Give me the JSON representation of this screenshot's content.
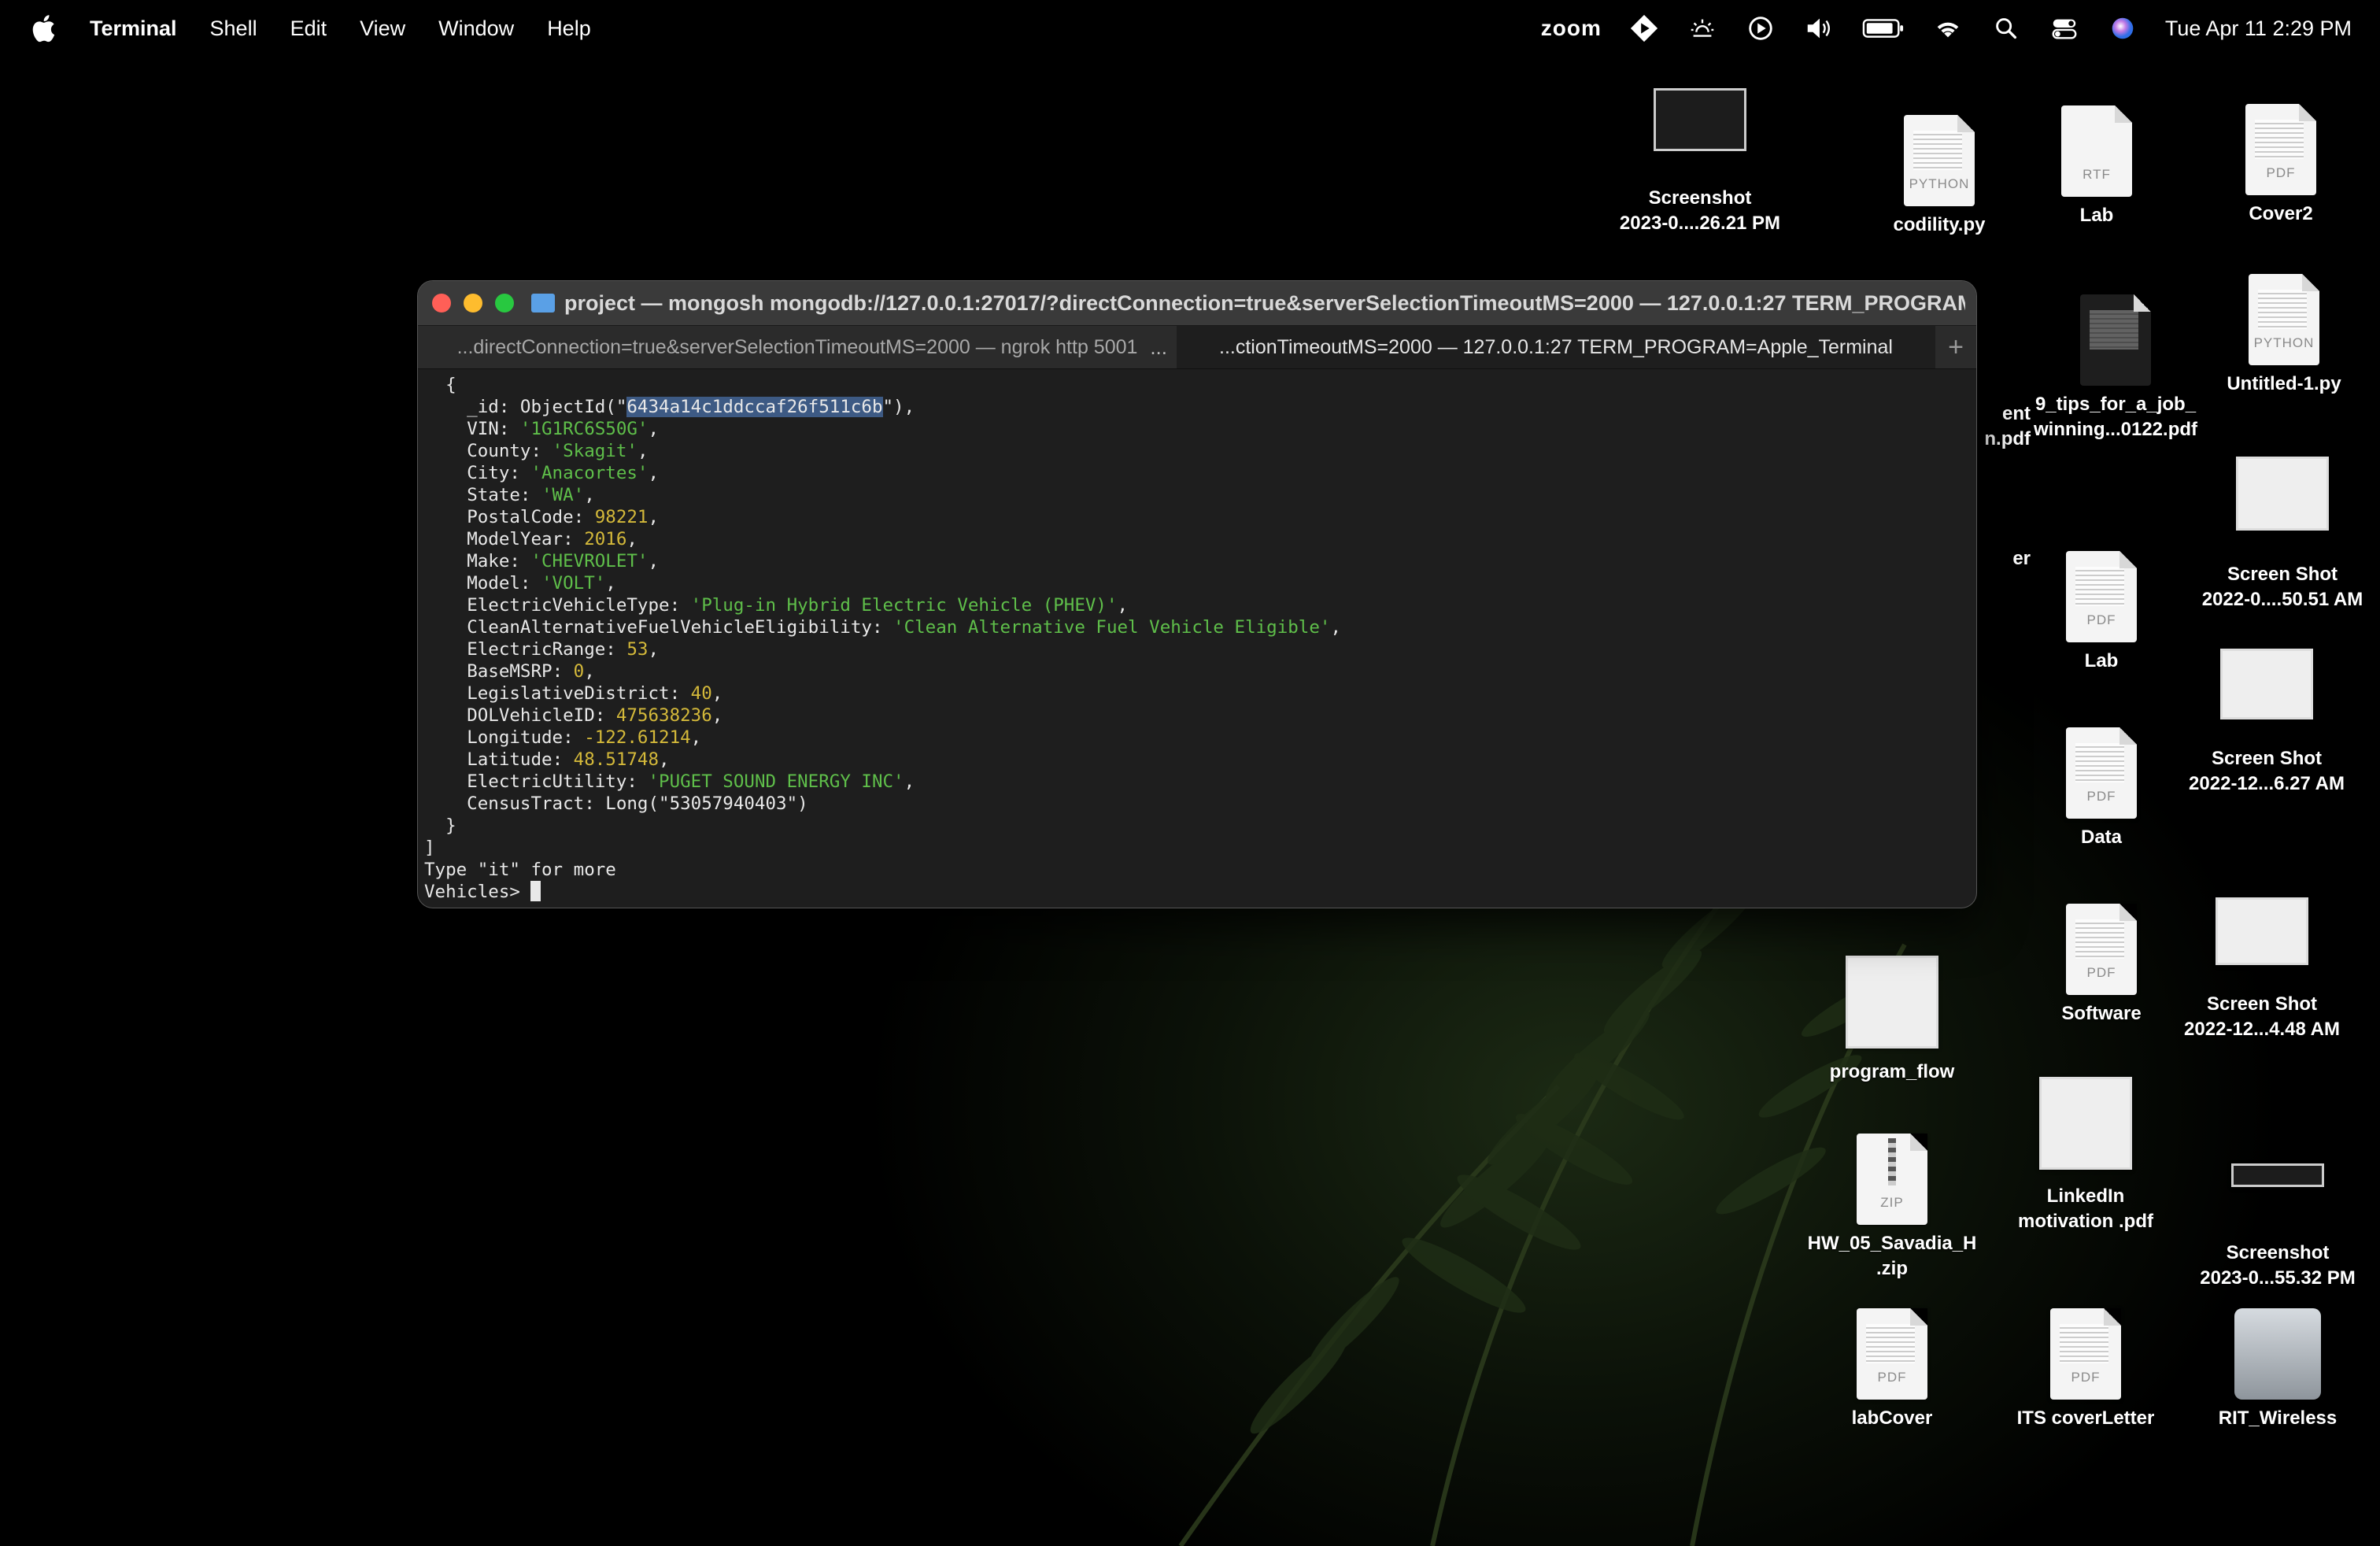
{
  "menubar": {
    "app_name": "Terminal",
    "items": [
      "Shell",
      "Edit",
      "View",
      "Window",
      "Help"
    ],
    "zoom_label": "zoom",
    "clock": "Tue Apr 11  2:29 PM",
    "icons": [
      "apple-icon",
      "zoom-status",
      "play-diamond-icon",
      "sun-icon",
      "play-circle-icon",
      "volume-icon",
      "battery-icon",
      "wifi-icon",
      "search-icon",
      "control-center-icon",
      "siri-icon"
    ]
  },
  "desktop_icons": [
    {
      "label": "Screenshot\n2023-0....26.21 PM",
      "kind": "screenshot"
    },
    {
      "label": "codility.py",
      "kind": "doc",
      "tag": "PYTHON"
    },
    {
      "label": "Lab",
      "kind": "doc",
      "tag": "RTF"
    },
    {
      "label": "Cover2",
      "kind": "doc",
      "tag": "PDF"
    },
    {
      "label": "ent\nn.pdf",
      "kind": "partial"
    },
    {
      "label": "9_tips_for_a_job_\nwinning...0122.pdf",
      "kind": "dark-doc"
    },
    {
      "label": "Untitled-1.py",
      "kind": "doc",
      "tag": "PYTHON"
    },
    {
      "label": "er",
      "kind": "partial"
    },
    {
      "label": "Screen Shot\n2022-0....50.51 AM",
      "kind": "screenshot"
    },
    {
      "label": "Lab",
      "kind": "doc",
      "tag": "PDF"
    },
    {
      "label": "Screen Shot\n2022-12...6.27 AM",
      "kind": "screenshot"
    },
    {
      "label": "Data",
      "kind": "doc",
      "tag": "PDF"
    },
    {
      "label": "Software",
      "kind": "doc",
      "tag": "PDF"
    },
    {
      "label": "Screen Shot\n2022-12...4.48 AM",
      "kind": "screenshot"
    },
    {
      "label": "program_flow",
      "kind": "screenshot"
    },
    {
      "label": "LinkedIn\nmotivation .pdf",
      "kind": "screenshot"
    },
    {
      "label": "HW_05_Savadia_H\n.zip",
      "kind": "doc",
      "tag": "ZIP"
    },
    {
      "label": "Screenshot\n2023-0...55.32 PM",
      "kind": "screenshot"
    },
    {
      "label": "labCover",
      "kind": "doc",
      "tag": "PDF"
    },
    {
      "label": "ITS coverLetter",
      "kind": "doc",
      "tag": "PDF"
    },
    {
      "label": "RIT_Wireless",
      "kind": "disk"
    }
  ],
  "terminal": {
    "title": "project — mongosh mongodb://127.0.0.1:27017/?directConnection=true&serverSelectionTimeoutMS=2000 — 127.0.0.1:27 TERM_PROGRAM...",
    "tabs": [
      {
        "label": "...directConnection=true&serverSelectionTimeoutMS=2000 — ngrok http 5001",
        "active": false
      },
      {
        "label": "...ctionTimeoutMS=2000 — 127.0.0.1:27 TERM_PROGRAM=Apple_Terminal",
        "active": true
      }
    ],
    "tab_more": "...",
    "tab_add": "+",
    "document": {
      "_id": "6434a14c1ddccaf26f511c6b",
      "fields": [
        {
          "key": "VIN",
          "value": "'1G1RC6S50G'",
          "type": "string"
        },
        {
          "key": "County",
          "value": "'Skagit'",
          "type": "string"
        },
        {
          "key": "City",
          "value": "'Anacortes'",
          "type": "string"
        },
        {
          "key": "State",
          "value": "'WA'",
          "type": "string"
        },
        {
          "key": "PostalCode",
          "value": "98221",
          "type": "number"
        },
        {
          "key": "ModelYear",
          "value": "2016",
          "type": "number"
        },
        {
          "key": "Make",
          "value": "'CHEVROLET'",
          "type": "string"
        },
        {
          "key": "Model",
          "value": "'VOLT'",
          "type": "string"
        },
        {
          "key": "ElectricVehicleType",
          "value": "'Plug-in Hybrid Electric Vehicle (PHEV)'",
          "type": "string"
        },
        {
          "key": "CleanAlternativeFuelVehicleEligibility",
          "value": "'Clean Alternative Fuel Vehicle Eligible'",
          "type": "string"
        },
        {
          "key": "ElectricRange",
          "value": "53",
          "type": "number"
        },
        {
          "key": "BaseMSRP",
          "value": "0",
          "type": "number"
        },
        {
          "key": "LegislativeDistrict",
          "value": "40",
          "type": "number"
        },
        {
          "key": "DOLVehicleID",
          "value": "475638236",
          "type": "number"
        },
        {
          "key": "Longitude",
          "value": "-122.61214",
          "type": "number"
        },
        {
          "key": "Latitude",
          "value": "48.51748",
          "type": "number"
        },
        {
          "key": "ElectricUtility",
          "value": "'PUGET SOUND ENERGY INC'",
          "type": "string"
        }
      ],
      "census_tract": "53057940403"
    },
    "more_hint": "Type \"it\" for more",
    "prompt": "Vehicles> "
  },
  "colors": {
    "string": "#5fbf4a",
    "number": "#d4b93a",
    "selection": "#3d5a84"
  }
}
